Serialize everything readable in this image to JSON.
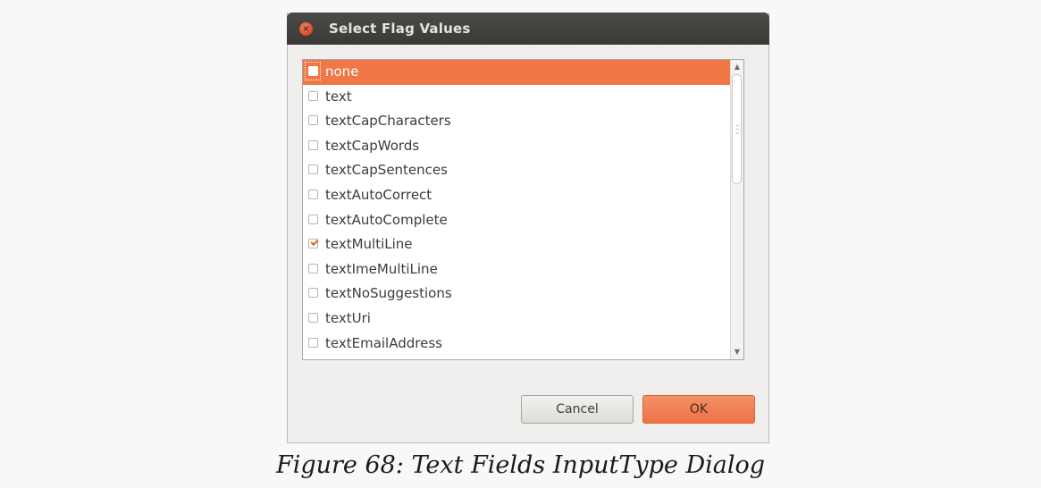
{
  "dialog": {
    "title": "Select Flag Values",
    "close_icon": "close-icon",
    "items": [
      {
        "label": "none",
        "checked": false,
        "selected": true
      },
      {
        "label": "text",
        "checked": false,
        "selected": false
      },
      {
        "label": "textCapCharacters",
        "checked": false,
        "selected": false
      },
      {
        "label": "textCapWords",
        "checked": false,
        "selected": false
      },
      {
        "label": "textCapSentences",
        "checked": false,
        "selected": false
      },
      {
        "label": "textAutoCorrect",
        "checked": false,
        "selected": false
      },
      {
        "label": "textAutoComplete",
        "checked": false,
        "selected": false
      },
      {
        "label": "textMultiLine",
        "checked": true,
        "selected": false
      },
      {
        "label": "textImeMultiLine",
        "checked": false,
        "selected": false
      },
      {
        "label": "textNoSuggestions",
        "checked": false,
        "selected": false
      },
      {
        "label": "textUri",
        "checked": false,
        "selected": false
      },
      {
        "label": "textEmailAddress",
        "checked": false,
        "selected": false
      }
    ],
    "buttons": {
      "cancel": "Cancel",
      "ok": "OK"
    },
    "colors": {
      "accent": "#f07746",
      "titlebar": "#3f3e3a"
    }
  },
  "caption": "Figure 68: Text Fields InputType Dialog"
}
